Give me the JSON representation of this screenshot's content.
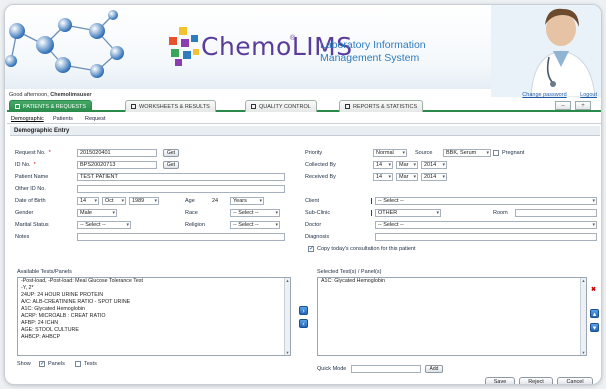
{
  "app": {
    "logo_text": "ChemoLIMS",
    "logo_mark": "®",
    "tagline": "Laboratory Information Management System"
  },
  "statusline": {
    "greeting": "Good afternoon, ",
    "user": "Chemolimsuser",
    "change_password": "Change password",
    "logout": "Logout"
  },
  "tabs": [
    {
      "label": "PATIENTS & REQUESTS",
      "active": true
    },
    {
      "label": "WORKSHEETS & RESULTS",
      "active": false
    },
    {
      "label": "QUALITY CONTROL",
      "active": false
    },
    {
      "label": "REPORTS & STATISTICS",
      "active": false
    }
  ],
  "window_buttons": [
    "–",
    "+"
  ],
  "subtabs": [
    {
      "label": "Demographic",
      "active": true
    },
    {
      "label": "Patients",
      "active": false
    },
    {
      "label": "Request",
      "active": false
    }
  ],
  "section_title": "Demographic Entry",
  "form": {
    "request_no": {
      "label": "Request No.",
      "value": "2015020401",
      "button": "Get"
    },
    "id_no": {
      "label": "ID No.",
      "value": "BPS20020713",
      "button": "Get"
    },
    "patient_name": {
      "label": "Patient Name",
      "value": "TEST PATIENT"
    },
    "other_id": {
      "label": "Other ID No."
    },
    "dob": {
      "label": "Date of Birth",
      "day": "14",
      "month": "Oct",
      "year": "1989",
      "age_label": "Age",
      "age": "24",
      "age_unit": "Years"
    },
    "gender": {
      "label": "Gender",
      "value": "Male",
      "race_label": "Race",
      "race_value": "-- Select --"
    },
    "marital": {
      "label": "Marital Status",
      "value": "-- Select --",
      "religion_label": "Religion",
      "religion_value": "-- Select --"
    },
    "notes": {
      "label": "Notes"
    },
    "priority": {
      "label": "Priority",
      "value": "Normal",
      "source_label": "Source",
      "source_value": "BBK, Serum",
      "pregnant_label": "Pregnant"
    },
    "collected_by": {
      "label": "Collected By",
      "day": "14",
      "month": "Mar",
      "year": "2014"
    },
    "received_by": {
      "label": "Received By",
      "day": "14",
      "month": "Mar",
      "year": "2014"
    },
    "client": {
      "label": "Client",
      "value": "-- Select --"
    },
    "sub_clinic": {
      "label": "Sub-Clinic",
      "value": "OTHER",
      "room_label": "Room"
    },
    "doctor": {
      "label": "Doctor",
      "value": "-- Select --"
    },
    "diagnosis": {
      "label": "Diagnosis"
    },
    "copy_consultation": {
      "label": "Copy today's consultation for this patient",
      "checked": true
    }
  },
  "available": {
    "header": "Available Tests/Panels",
    "items": [
      "-Post-load, -Post-load: Meal Glucose Tolerance Test",
      "-Y, 2*",
      "24UP: 24 HOUR URINE PROTEIN",
      "A/C: ALB-CREATININE RATIO - SPOT URINE",
      "A1C: Glycated Hemoglobin",
      "ACRP: MICROALB : CREAT RATIO",
      "AFBP: 24 ICHN",
      "AGE: STOOL CULTURE",
      "AHBCP: AHBCP"
    ],
    "show_label": "Show",
    "panels_label": "Panels",
    "tests_label": "Tests"
  },
  "selected": {
    "header": "Selected Test(s) / Panel(s)",
    "items": [
      "A1C: Glycated Hemoglobin"
    ],
    "quick_mode_label": "Quick Mode",
    "add_label": "Add"
  },
  "actions": {
    "save": "Save",
    "reject": "Reject",
    "cancel": "Cancel"
  },
  "colors": {
    "brand_purple": "#5a3d9a",
    "tagline_blue": "#2e7cc0",
    "tab_green": "#2a8a4a",
    "button_blue": "#2266b8"
  }
}
